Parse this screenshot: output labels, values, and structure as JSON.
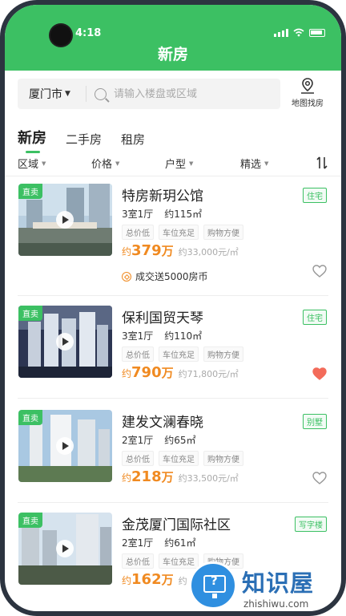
{
  "status": {
    "time": "4:18"
  },
  "header": {
    "title": "新房"
  },
  "search": {
    "city": "厦门市",
    "placeholder": "请输入楼盘或区域",
    "map_label": "地图找房"
  },
  "tabs": [
    {
      "label": "新房",
      "active": true
    },
    {
      "label": "二手房",
      "active": false
    },
    {
      "label": "租房",
      "active": false
    }
  ],
  "filters": [
    "区域",
    "价格",
    "户型",
    "精选"
  ],
  "listings": [
    {
      "badge": "直卖",
      "name": "特房新玥公馆",
      "type": "住宅",
      "layout": "3室1厅",
      "area": "约115㎡",
      "features": [
        "总价低",
        "车位充足",
        "购物方便"
      ],
      "price_prefix": "约",
      "price": "379",
      "price_unit": "万",
      "unit_price": "约33,000元/㎡",
      "promo": "成交送5000房币",
      "favorited": false
    },
    {
      "badge": "直卖",
      "name": "保利国贸天琴",
      "type": "住宅",
      "layout": "3室1厅",
      "area": "约110㎡",
      "features": [
        "总价低",
        "车位充足",
        "购物方便"
      ],
      "price_prefix": "约",
      "price": "790",
      "price_unit": "万",
      "unit_price": "约71,800元/㎡",
      "favorited": true
    },
    {
      "badge": "直卖",
      "name": "建发文澜春晓",
      "type": "别墅",
      "layout": "2室1厅",
      "area": "约65㎡",
      "features": [
        "总价低",
        "车位充足",
        "购物方便"
      ],
      "price_prefix": "约",
      "price": "218",
      "price_unit": "万",
      "unit_price": "约33,500元/㎡",
      "favorited": false
    },
    {
      "badge": "直卖",
      "name": "金茂厦门国际社区",
      "type": "写字楼",
      "layout": "2室1厅",
      "area": "约61㎡",
      "features": [
        "总价低",
        "车位充足",
        "购物方便"
      ],
      "price_prefix": "约",
      "price": "162",
      "price_unit": "万",
      "unit_price": "约",
      "favorited": false
    }
  ],
  "watermark": {
    "text": "知识屋",
    "url": "zhishiwu.com"
  },
  "colors": {
    "brand": "#3cc063",
    "price": "#f08a21",
    "favorite": "#f36b5a"
  }
}
